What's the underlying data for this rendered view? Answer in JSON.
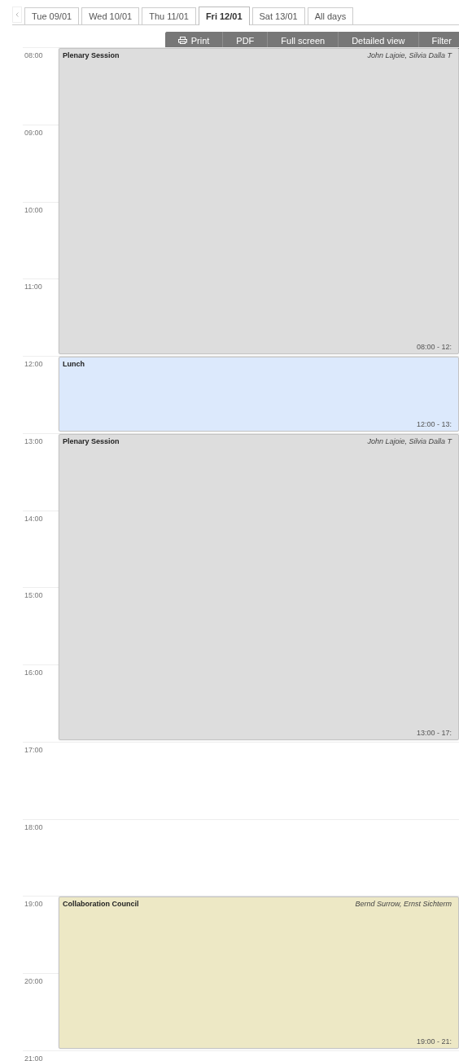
{
  "day_tabs": [
    {
      "label": "Tue 09/01",
      "selected": false
    },
    {
      "label": "Wed 10/01",
      "selected": false
    },
    {
      "label": "Thu 11/01",
      "selected": false
    },
    {
      "label": "Fri 12/01",
      "selected": true
    },
    {
      "label": "Sat 13/01",
      "selected": false
    },
    {
      "label": "All days",
      "selected": false
    }
  ],
  "toolbar": [
    {
      "label": "Print"
    },
    {
      "label": "PDF"
    },
    {
      "label": "Full screen"
    },
    {
      "label": "Detailed view"
    },
    {
      "label": "Filter"
    }
  ],
  "hours": [
    {
      "label": "08:00",
      "kind": "start",
      "event": {
        "title": "Plenary Session",
        "speakers": "John Lajoie, Silvia Dalla T",
        "time": "08:00 - 12:",
        "color": "#dddddd"
      }
    },
    {
      "label": "09:00",
      "kind": "continued"
    },
    {
      "label": "10:00",
      "kind": "continued"
    },
    {
      "label": "11:00",
      "kind": "continued"
    },
    {
      "label": "12:00",
      "kind": "start",
      "event": {
        "title": "Lunch",
        "time": "12:00 - 13:",
        "color": "#dce9fc"
      }
    },
    {
      "label": "13:00",
      "kind": "start",
      "event": {
        "title": "Plenary Session",
        "speakers": "John Lajoie, Silvia Dalla T",
        "time": "13:00 - 17:",
        "color": "#dddddd"
      }
    },
    {
      "label": "14:00",
      "kind": "continued"
    },
    {
      "label": "15:00",
      "kind": "continued"
    },
    {
      "label": "16:00",
      "kind": "continued"
    },
    {
      "label": "17:00",
      "kind": "free"
    },
    {
      "label": "18:00",
      "kind": "free"
    },
    {
      "label": "19:00",
      "kind": "start",
      "event": {
        "title": "Collaboration Council",
        "speakers": "Bernd Surrow, Ernst Sichterm",
        "time": "19:00 - 21:",
        "color": "#ede8c5"
      }
    },
    {
      "label": "20:00",
      "kind": "continued"
    },
    {
      "label": "21:00",
      "kind": "free"
    }
  ]
}
